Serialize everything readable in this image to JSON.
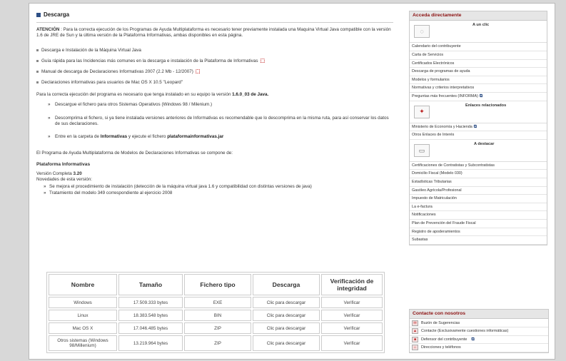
{
  "main": {
    "title": "Descarga",
    "atencion_label": "ATENCIÓN",
    "atencion_text": ": Para la correcta ejecución de los Programas de Ayuda Multiplataforma es necesario tener previamente instalada una Maquina Virtual Java compatible con la versión 1.6 de JRE de Sun y la última versión de la Plataforma Informativas, ambas disponibles en esta página.",
    "links": [
      "Descarga e Instalación de la Máquina Virtual Java",
      "Guía rápida para las Incidencias más comunes en la descarga e instalación de la Plataforma de Informativas",
      "Manual de descarga de Declaraciones Informativas 2007 (2.2 Mb - 12/2007)",
      "Declaraciones informativas para usuarios de Mac OS X 10.5 \"Leopard\""
    ],
    "requirement_text": "Para la correcta ejecución del programa es necesario que tenga instalado en su equipo la versión",
    "requirement_version": "1.6.0_03 de Java.",
    "steps": {
      "s1": "Descargue el fichero para otros Sistemas Operativos (Windows 98 / Milenium.)",
      "s2": "Descomprima el fichero, si ya tiene instalada versiones anteriores de Informativas es recomendable que lo descomprima en la misma ruta, para así conservar los datos de sus declaraciones.",
      "s3_a": "Entre en la carpeta de",
      "s3_b": "Informativas",
      "s3_c": "y ejecute el fichero",
      "s3_d": "plataformainformativas.jar"
    },
    "program_intro": "El Programa de Ayuda Multiplataforma de Modelos de Declaraciones Informativas se compone de:",
    "platform_title": "Plataforma Informativas",
    "version_label": "Versión Completa",
    "version_value": "3.20",
    "novedades": "Novedades de esta versión:",
    "novedades_items": [
      "Se mejora el procedimiento de instalación (detección de la máquina virtual java 1.6 y compatibilidad con distintas versiones de java)",
      "Tratamiento del modelo 349 correspondiente al ejercicio 2008"
    ],
    "table": {
      "headers": [
        "Nombre",
        "Tamaño",
        "Fichero tipo",
        "Descarga",
        "Verificación de integridad"
      ],
      "rows": [
        [
          "Windows",
          "17.509.333 bytes",
          "EXE",
          "Clic para descargar",
          "Verificar"
        ],
        [
          "Linux",
          "18.383.548 bytes",
          "BIN",
          "Clic para descargar",
          "Verificar"
        ],
        [
          "Mac OS X",
          "17.046.485 bytes",
          "ZIP",
          "Clic para descargar",
          "Verificar"
        ],
        [
          "Otros sistemas (Windows 98/Millenium)",
          "13.219.964 bytes",
          "ZIP",
          "Clic para descargar",
          "Verificar"
        ]
      ]
    }
  },
  "sidebar": {
    "acceda_title": "Acceda directamente",
    "a_un_clic": "A un clic",
    "a_un_clic_items": [
      "Calendario del contribuyente",
      "Carta de Servicios",
      "Certificados Electrónicos",
      "Descarga de programas de ayuda",
      "Modelos y formularios",
      "Normativas y criterios interpretativos",
      "Preguntas más frecuentes (INFORMA)"
    ],
    "enlaces_title": "Enlaces relacionados",
    "enlaces_items": [
      "Ministerio de Economía y Hacienda",
      "Otros Enlaces de Interés"
    ],
    "destacar_title": "A destacar",
    "destacar_items": [
      "Certificaciones de Contratistas y Subcontratistas",
      "Domicilio Fiscal (Modelo 030)",
      "Estadísticas Tributarias",
      "Gasóleo Agrícola/Profesional",
      "Impuesto de Matriculación",
      "La e-factura",
      "Notificaciones",
      "Plan de Prevención del Fraude Fiscal",
      "Registro de apoderamientos",
      "Subastas"
    ],
    "contacte_title": "Contacte con nosotros",
    "contacte_items": [
      "Buzón de Sugerencias",
      "Contacte (Exclusivamente cuestiones informáticas)",
      "Defensor del contribuyente",
      "Direcciones y teléfonos"
    ]
  }
}
